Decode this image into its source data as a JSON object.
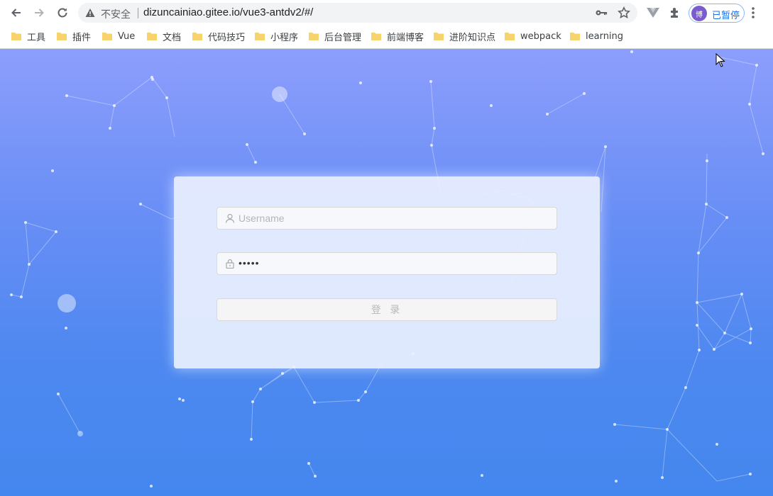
{
  "browser": {
    "omnibox": {
      "security_label": "不安全",
      "url": "dizuncainiao.gitee.io/vue3-antdv2/#/"
    },
    "profile": {
      "avatar_text": "博",
      "status_label": "已暂停"
    }
  },
  "bookmarks": [
    {
      "label": "工具"
    },
    {
      "label": "插件"
    },
    {
      "label": "Vue"
    },
    {
      "label": "文档"
    },
    {
      "label": "代码技巧"
    },
    {
      "label": "小程序"
    },
    {
      "label": "后台管理"
    },
    {
      "label": "前端博客"
    },
    {
      "label": "进阶知识点"
    },
    {
      "label": "webpack"
    },
    {
      "label": "learning"
    }
  ],
  "login": {
    "username_placeholder": "Username",
    "password_mask": "•••••",
    "submit_label": "登 录"
  },
  "colors": {
    "background_top": "#8d9efc",
    "background_bottom": "#4487ee",
    "folder": "#f6d46b",
    "link_accent": "#1a73e8"
  }
}
